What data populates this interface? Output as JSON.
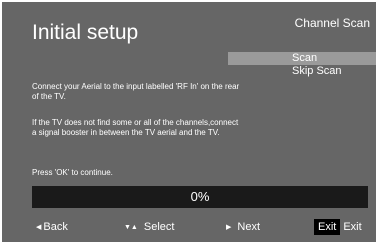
{
  "title": "Initial setup",
  "header_right": "Channel Scan",
  "options": [
    {
      "label": "Scan",
      "selected": true
    },
    {
      "label": "Skip Scan",
      "selected": false
    }
  ],
  "instructions": {
    "line1": "Connect your Aerial to the input labelled 'RF In' on the rear of the TV.",
    "line2": "If the TV does not find some or all of the channels,connect a signal booster in between the TV aerial and the TV.",
    "line3": "Press 'OK' to continue."
  },
  "progress": {
    "label": "0%",
    "fraction": 0
  },
  "footer": {
    "back": {
      "icon": "left-triangle-icon",
      "label": "Back"
    },
    "select": {
      "icon": "up-down-triangle-icon",
      "label": "Select"
    },
    "next": {
      "icon": "right-triangle-icon",
      "label": "Next"
    },
    "exit": {
      "key_label": "Exit",
      "label": "Exit"
    }
  },
  "colors": {
    "background": "#666666",
    "selected_highlight": "#9a9a9a",
    "progress_track": "#1a1a1a",
    "text": "#ffffff"
  }
}
